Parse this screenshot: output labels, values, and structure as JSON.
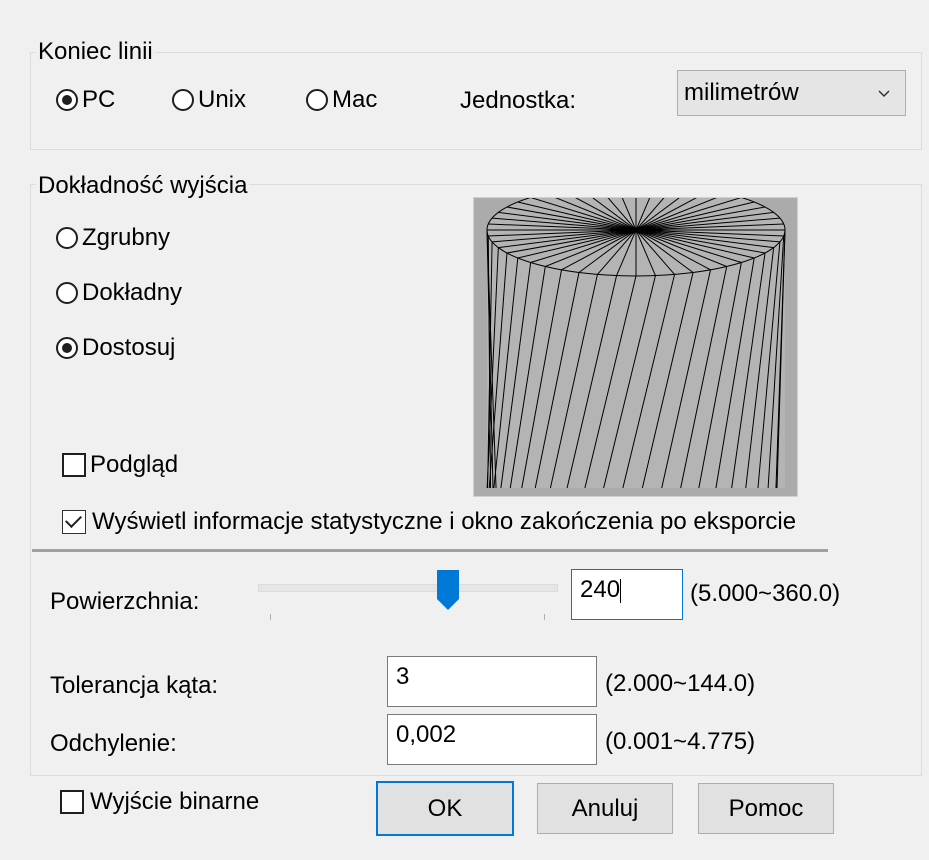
{
  "line_ending": {
    "group_title": "Koniec linii",
    "options": [
      {
        "label": "PC",
        "selected": true
      },
      {
        "label": "Unix",
        "selected": false
      },
      {
        "label": "Mac",
        "selected": false
      }
    ],
    "unit_label": "Jednostka:",
    "unit_value": "milimetrów"
  },
  "precision": {
    "group_title": "Dokładność wyjścia",
    "options": [
      {
        "label": "Zgrubny",
        "selected": false
      },
      {
        "label": "Dokładny",
        "selected": false
      },
      {
        "label": "Dostosuj",
        "selected": true
      }
    ],
    "preview_label": "Podgląd",
    "preview_checked": false,
    "stats_label": "Wyświetl informacje statystyczne i okno zakończenia po eksporcie",
    "stats_checked": true
  },
  "surface": {
    "label": "Powierzchnia:",
    "value": "240",
    "range": "(5.000~360.0)",
    "slider_fraction": 0.65
  },
  "angle_tolerance": {
    "label": "Tolerancja kąta:",
    "value": "3",
    "range": "(2.000~144.0)"
  },
  "deviation": {
    "label": "Odchylenie:",
    "value": "0,002",
    "range": "(0.001~4.775)"
  },
  "binary_output": {
    "label": "Wyjście binarne",
    "checked": false
  },
  "buttons": {
    "ok": "OK",
    "cancel": "Anuluj",
    "help": "Pomoc"
  },
  "icons": {
    "dropdown": "chevron-down-icon",
    "slider": "slider-thumb-icon"
  },
  "colors": {
    "accent": "#0078d7",
    "background": "#f0f0f0",
    "preview_bg": "#ababab"
  }
}
